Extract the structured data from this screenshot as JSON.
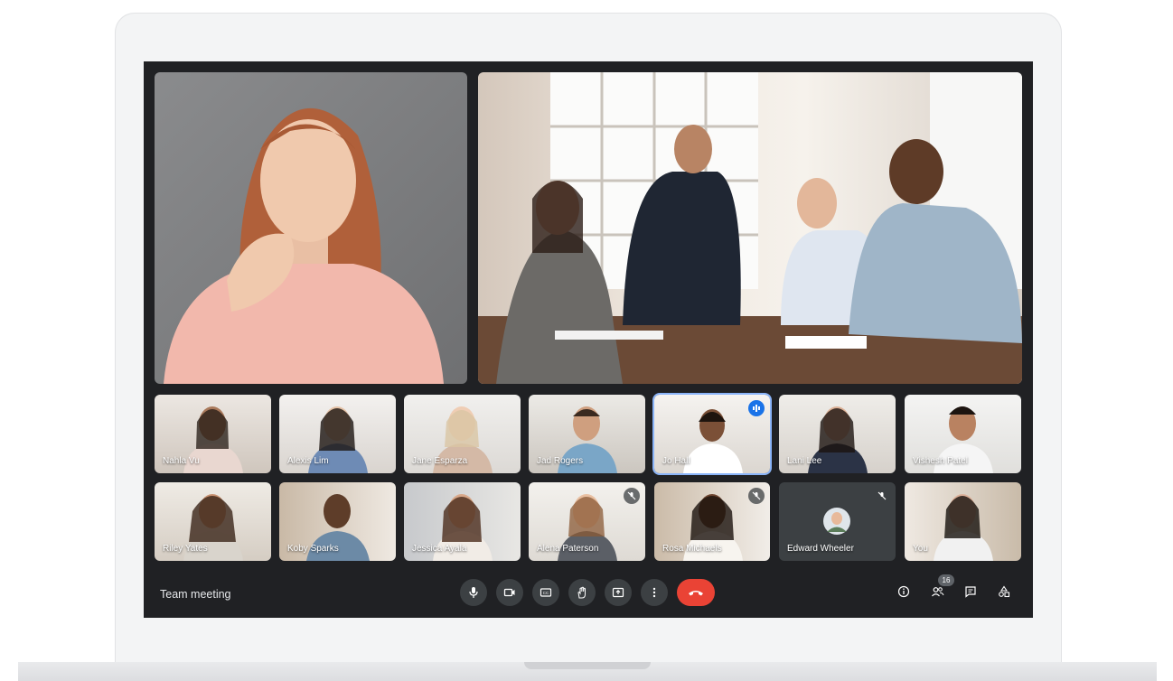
{
  "meeting": {
    "title": "Team meeting",
    "participant_count": "16"
  },
  "colors": {
    "screen_bg": "#202124",
    "control_bg": "#3c4043",
    "end_call": "#ea4335",
    "active_speaker": "#8ab4f8",
    "speaking_badge": "#1a73e8"
  },
  "participants": [
    {
      "name": "Nahla Vu"
    },
    {
      "name": "Alexis Lim"
    },
    {
      "name": "Jane Esparza"
    },
    {
      "name": "Jad Rogers"
    },
    {
      "name": "Jo Hall",
      "speaking": true
    },
    {
      "name": "Lani Lee"
    },
    {
      "name": "Vishesh Patel"
    },
    {
      "name": "Riley Yates"
    },
    {
      "name": "Koby Sparks"
    },
    {
      "name": "Jessica Ayala"
    },
    {
      "name": "Alena Paterson",
      "muted": true
    },
    {
      "name": "Rosa Michaels",
      "muted": true
    },
    {
      "name": "Edward Wheeler",
      "muted": true,
      "camera_off": true
    },
    {
      "name": "You"
    }
  ],
  "controls": [
    "mic-icon",
    "camera-icon",
    "captions-icon",
    "raise-hand-icon",
    "present-icon",
    "more-options-icon",
    "end-call-icon"
  ],
  "side_controls": [
    "info-icon",
    "people-icon",
    "chat-icon",
    "activities-icon"
  ]
}
